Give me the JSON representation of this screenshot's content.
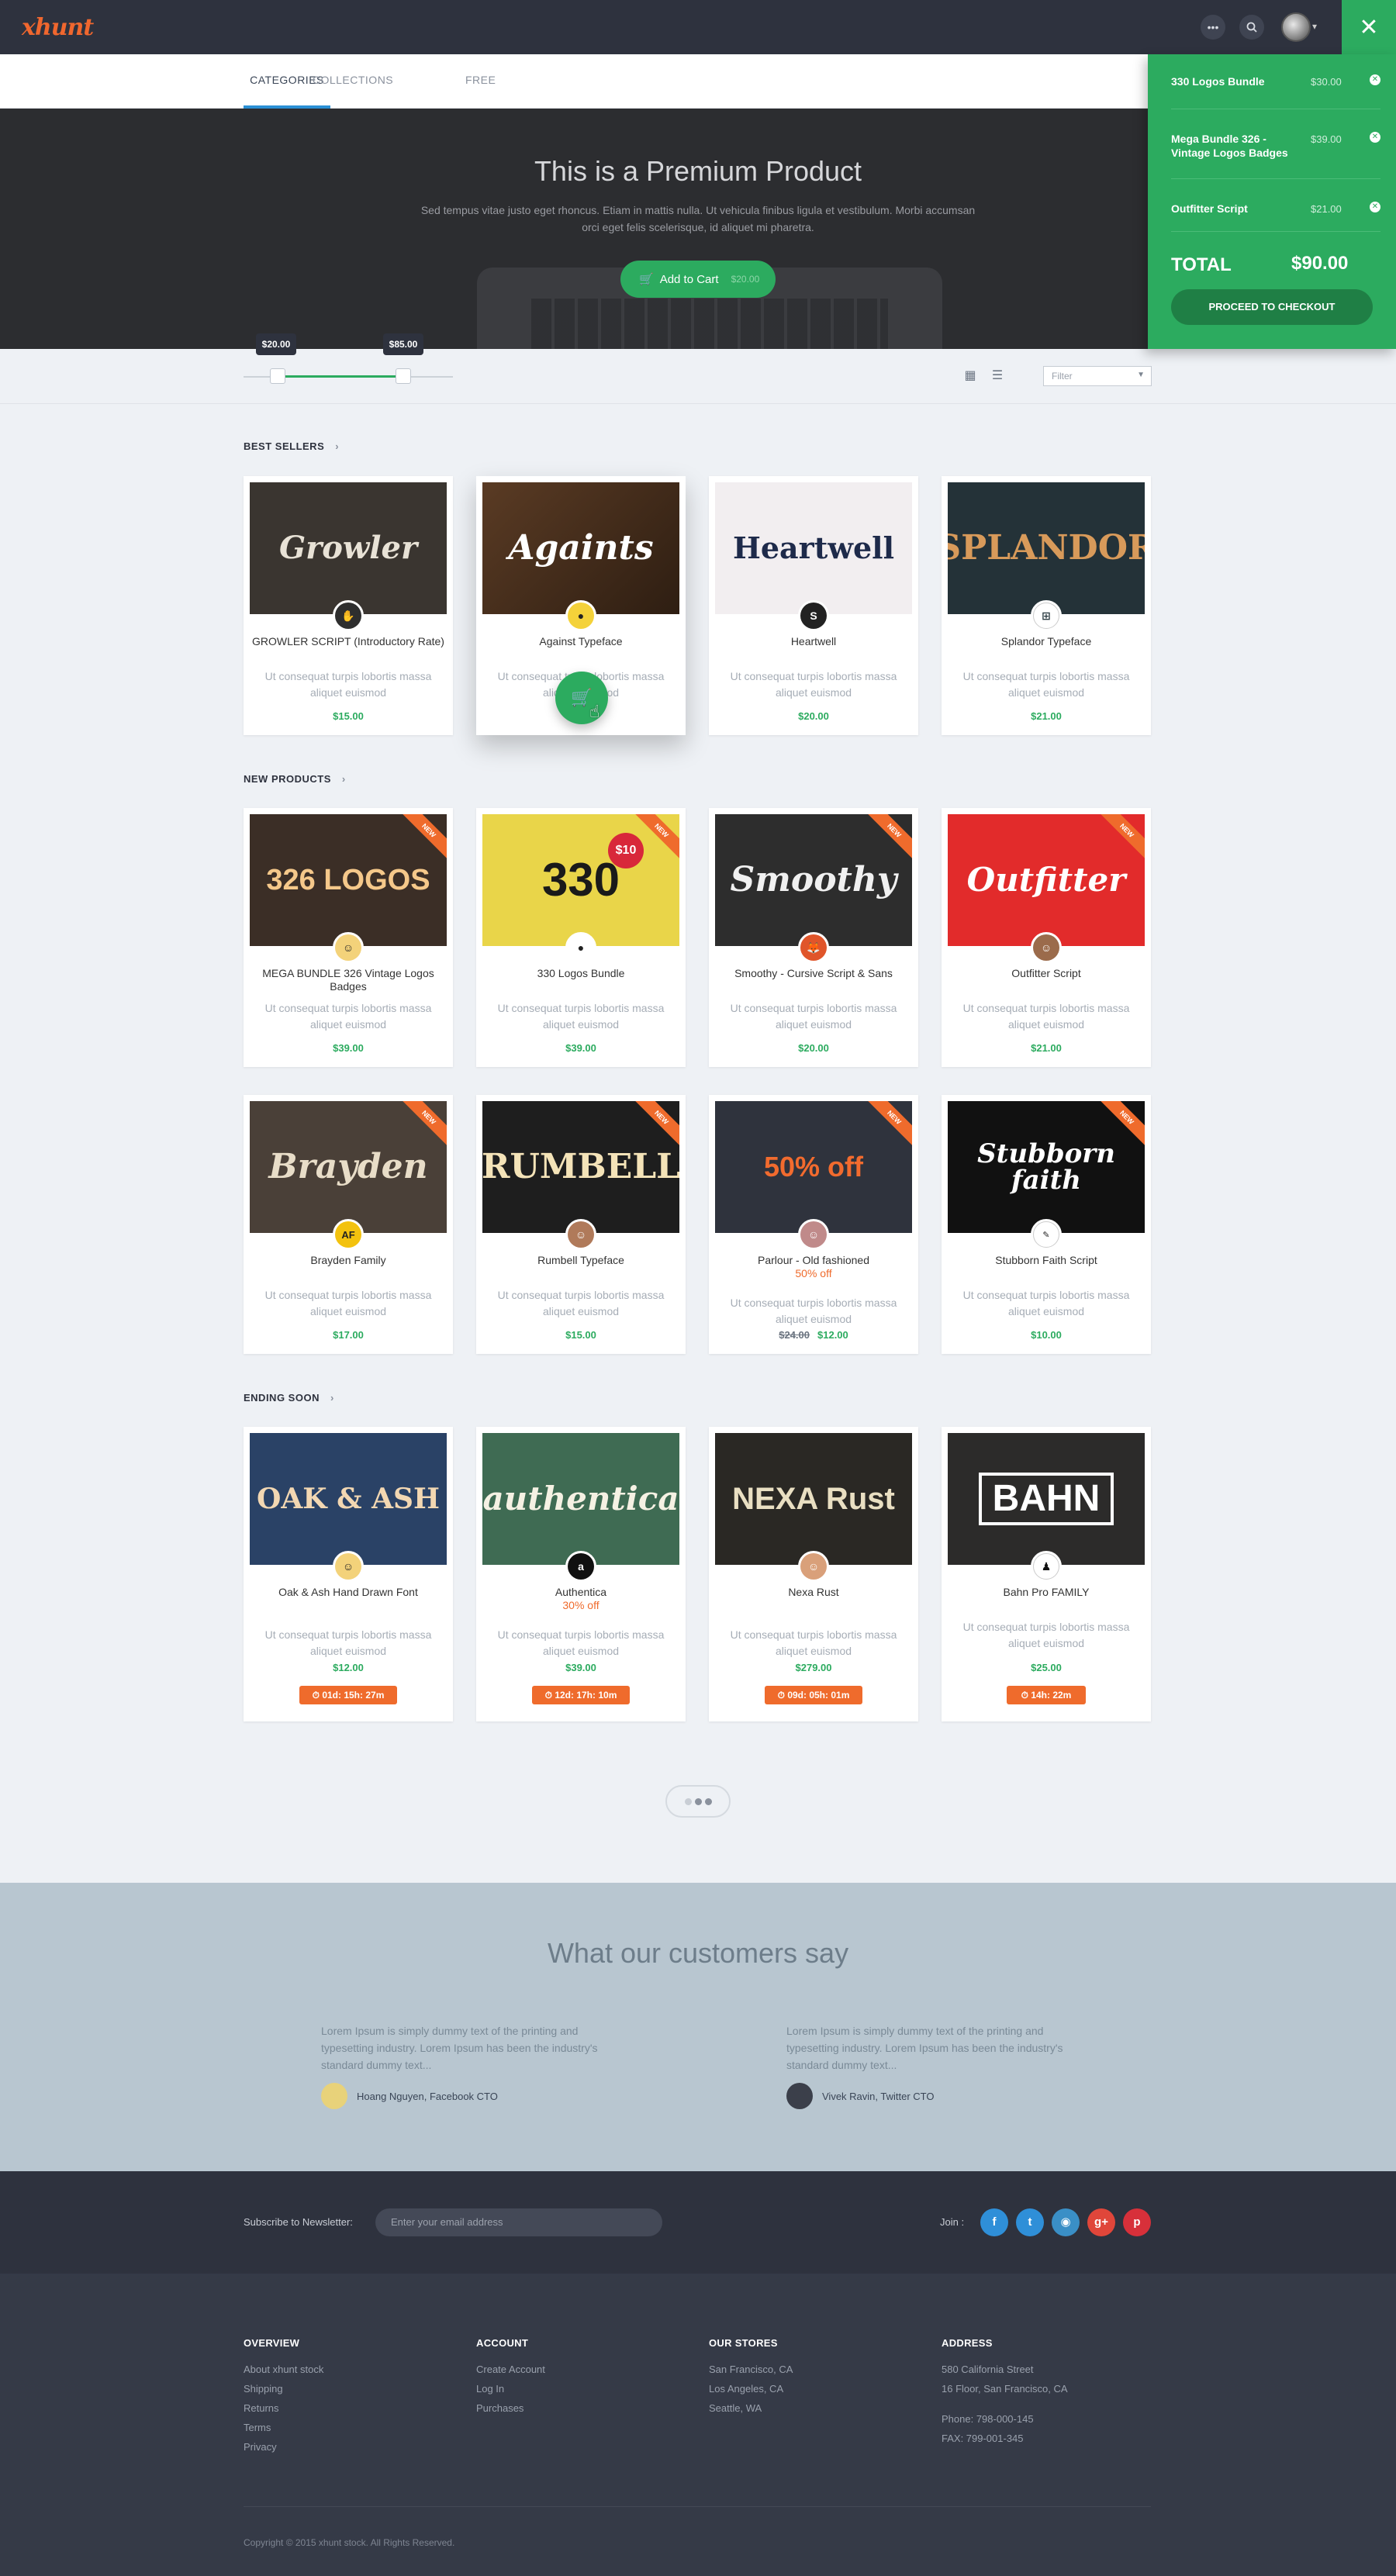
{
  "topbar": {
    "logo": "xhunt",
    "more_icon": "ellipsis-icon",
    "search_icon": "search-icon",
    "close_icon": "close-icon"
  },
  "subnav": {
    "tabs": [
      {
        "label": "CATEGORIES",
        "active": true
      },
      {
        "label": "COLLECTIONS",
        "active": false
      },
      {
        "label": "FREE",
        "active": false
      }
    ]
  },
  "hero": {
    "title": "This is a Premium Product",
    "description": "Sed tempus vitae justo eget rhoncus. Etiam in mattis nulla. Ut vehicula finibus ligula et vestibulum. Morbi accumsan orci eget felis scelerisque, id aliquet mi pharetra.",
    "button_label": "Add to Cart",
    "button_price": "$20.00"
  },
  "cart": {
    "items": [
      {
        "name": "330 Logos Bundle",
        "price": "$30.00"
      },
      {
        "name": "Mega Bundle 326 - Vintage Logos Badges",
        "price": "$39.00"
      },
      {
        "name": "Outfitter Script",
        "price": "$21.00"
      }
    ],
    "total_label": "TOTAL",
    "total_value": "$90.00",
    "checkout_label": "PROCEED TO CHECKOUT"
  },
  "filters": {
    "price_min": "$20.00",
    "price_max": "$85.00",
    "filter_placeholder": "Filter"
  },
  "sections": {
    "best_sellers": "BEST SELLERS",
    "new_products": "NEW PRODUCTS",
    "ending_soon": "ENDING SOON"
  },
  "best_sellers": [
    {
      "name": "GROWLER SCRIPT (Introductory Rate)",
      "desc": "Ut consequat turpis lobortis massa aliquet euismod",
      "price": "$15.00",
      "art": "Growler"
    },
    {
      "name": "Against Typeface",
      "desc": "Ut consequat turpis lobortis massa aliquet euismod",
      "price": "",
      "art": "Againts"
    },
    {
      "name": "Heartwell",
      "desc": "Ut consequat turpis lobortis massa aliquet euismod",
      "price": "$20.00",
      "art": "Heartwell"
    },
    {
      "name": "Splandor Typeface",
      "desc": "Ut consequat turpis lobortis massa aliquet euismod",
      "price": "$21.00",
      "art": "SPLANDOR"
    }
  ],
  "new_products_row1": [
    {
      "name": "MEGA BUNDLE 326 Vintage Logos Badges",
      "desc": "Ut consequat turpis lobortis massa aliquet euismod",
      "price": "$39.00",
      "ribbon": "NEW",
      "art": "326 LOGOS"
    },
    {
      "name": "330 Logos Bundle",
      "desc": "Ut consequat turpis lobortis massa aliquet euismod",
      "price": "$39.00",
      "ribbon": "NEW",
      "art": "330",
      "badge": "$10"
    },
    {
      "name": "Smoothy - Cursive Script & Sans",
      "desc": "Ut consequat turpis lobortis massa aliquet euismod",
      "price": "$20.00",
      "ribbon": "NEW",
      "art": "Smoothy"
    },
    {
      "name": "Outfitter Script",
      "desc": "Ut consequat turpis lobortis massa aliquet euismod",
      "price": "$21.00",
      "ribbon": "NEW",
      "art": "Outfitter"
    }
  ],
  "new_products_row2": [
    {
      "name": "Brayden Family",
      "desc": "Ut consequat turpis lobortis massa aliquet euismod",
      "price": "$17.00",
      "ribbon": "NEW",
      "art": "Brayden"
    },
    {
      "name": "Rumbell Typeface",
      "desc": "Ut consequat turpis lobortis massa aliquet euismod",
      "price": "$15.00",
      "ribbon": "NEW",
      "art": "RUMBELL"
    },
    {
      "name": "Parlour - Old fashioned",
      "discount": "50% off",
      "desc": "Ut consequat turpis lobortis massa aliquet euismod",
      "old_price": "$24.00",
      "price": "$12.00",
      "ribbon": "NEW",
      "art": "50% off"
    },
    {
      "name": "Stubborn Faith Script",
      "desc": "Ut consequat turpis lobortis massa aliquet euismod",
      "price": "$10.00",
      "ribbon": "NEW",
      "art": "Stubborn faith"
    }
  ],
  "ending_soon": [
    {
      "name": "Oak & Ash Hand Drawn Font",
      "desc": "Ut consequat turpis lobortis massa aliquet euismod",
      "price": "$12.00",
      "timer": "01d: 15h: 27m",
      "art": "OAK & ASH"
    },
    {
      "name": "Authentica",
      "discount": "30% off",
      "desc": "Ut consequat turpis lobortis massa aliquet euismod",
      "price": "$39.00",
      "timer": "12d: 17h: 10m",
      "art": "authentica"
    },
    {
      "name": "Nexa Rust",
      "desc": "Ut consequat turpis lobortis massa aliquet euismod",
      "price": "$279.00",
      "timer": "09d: 05h: 01m",
      "art": "NEXA Rust"
    },
    {
      "name": "Bahn Pro FAMILY",
      "desc": "Ut consequat turpis lobortis massa aliquet euismod",
      "price": "$25.00",
      "timer": "14h: 22m",
      "art": "BAHN"
    }
  ],
  "testimonials": {
    "title": "What our customers say",
    "items": [
      {
        "text": "Lorem Ipsum is simply dummy text of the printing and typesetting industry. Lorem Ipsum has been the industry's standard dummy text...",
        "author": "Hoang Nguyen, Facebook CTO"
      },
      {
        "text": "Lorem Ipsum is simply dummy text of the printing and typesetting industry. Lorem Ipsum has been the industry's standard dummy text...",
        "author": "Vivek Ravin, Twitter CTO"
      }
    ]
  },
  "newsletter": {
    "label": "Subscribe to Newsletter:",
    "placeholder": "Enter your email address",
    "join_label": "Join :",
    "social": [
      {
        "icon": "facebook-icon",
        "glyph": "f",
        "color": "#2f8fd8"
      },
      {
        "icon": "twitter-icon",
        "glyph": "t",
        "color": "#2f8fd8"
      },
      {
        "icon": "instagram-icon",
        "glyph": "◉",
        "color": "#3a8fc6"
      },
      {
        "icon": "googleplus-icon",
        "glyph": "g+",
        "color": "#e0463a"
      },
      {
        "icon": "pinterest-icon",
        "glyph": "p",
        "color": "#d7303a"
      }
    ]
  },
  "footer": {
    "columns": [
      {
        "title": "OVERVIEW",
        "links": [
          "About xhunt stock",
          "Shipping",
          "Returns",
          "Terms",
          "Privacy"
        ]
      },
      {
        "title": "ACCOUNT",
        "links": [
          "Create Account",
          "Log In",
          "Purchases"
        ]
      },
      {
        "title": "OUR STORES",
        "links": [
          "San Francisco, CA",
          "Los Angeles, CA",
          "Seattle, WA"
        ]
      },
      {
        "title": "ADDRESS",
        "lines": [
          "580 California Street",
          "16 Floor, San Francisco, CA"
        ],
        "lines2": [
          "Phone: 798-000-145",
          "FAX: 799-001-345"
        ]
      }
    ],
    "copyright": "Copyright © 2015 xhunt stock. All Rights Reserved."
  },
  "colors": {
    "accent_green": "#2cab5f",
    "accent_orange": "#ef6b2c",
    "dark": "#2e323e"
  }
}
